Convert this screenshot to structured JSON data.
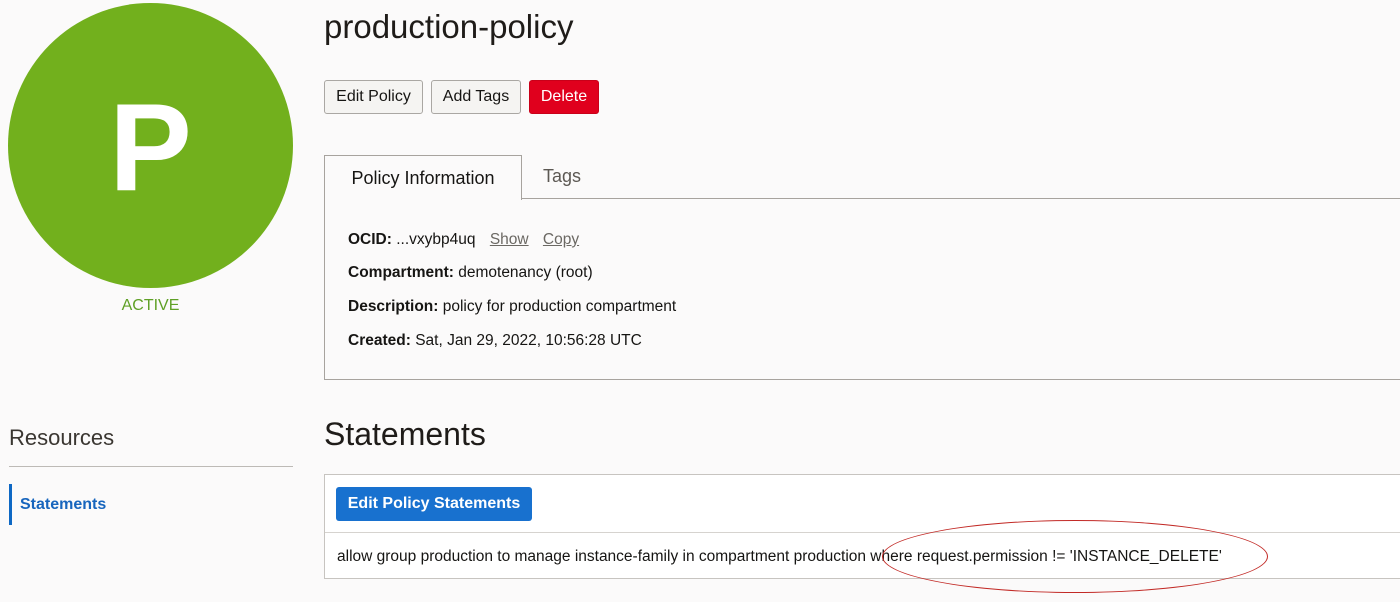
{
  "sidebar": {
    "avatar_letter": "P",
    "status": "ACTIVE",
    "resources_title": "Resources",
    "items": [
      {
        "label": "Statements",
        "active": true
      }
    ]
  },
  "header": {
    "title": "production-policy"
  },
  "actions": {
    "edit_policy": "Edit Policy",
    "add_tags": "Add Tags",
    "delete": "Delete"
  },
  "tabs": [
    {
      "label": "Policy Information",
      "active": true
    },
    {
      "label": "Tags",
      "active": false
    }
  ],
  "policy_info": {
    "ocid_label": "OCID:",
    "ocid_value": "...vxybp4uq",
    "show_link": "Show",
    "copy_link": "Copy",
    "compartment_label": "Compartment:",
    "compartment_value": "demotenancy (root)",
    "description_label": "Description:",
    "description_value": "policy for production compartment",
    "created_label": "Created:",
    "created_value": "Sat, Jan 29, 2022, 10:56:28 UTC"
  },
  "statements": {
    "heading": "Statements",
    "edit_button": "Edit Policy Statements",
    "rows": [
      "allow group production to manage instance-family in compartment production where request.permission != 'INSTANCE_DELETE'"
    ]
  },
  "colors": {
    "avatar": "#72b01d",
    "status": "#5fa025",
    "delete": "#e0001d",
    "primary": "#1871cf",
    "link_active": "#1765bd",
    "annotation": "#c22a26"
  }
}
